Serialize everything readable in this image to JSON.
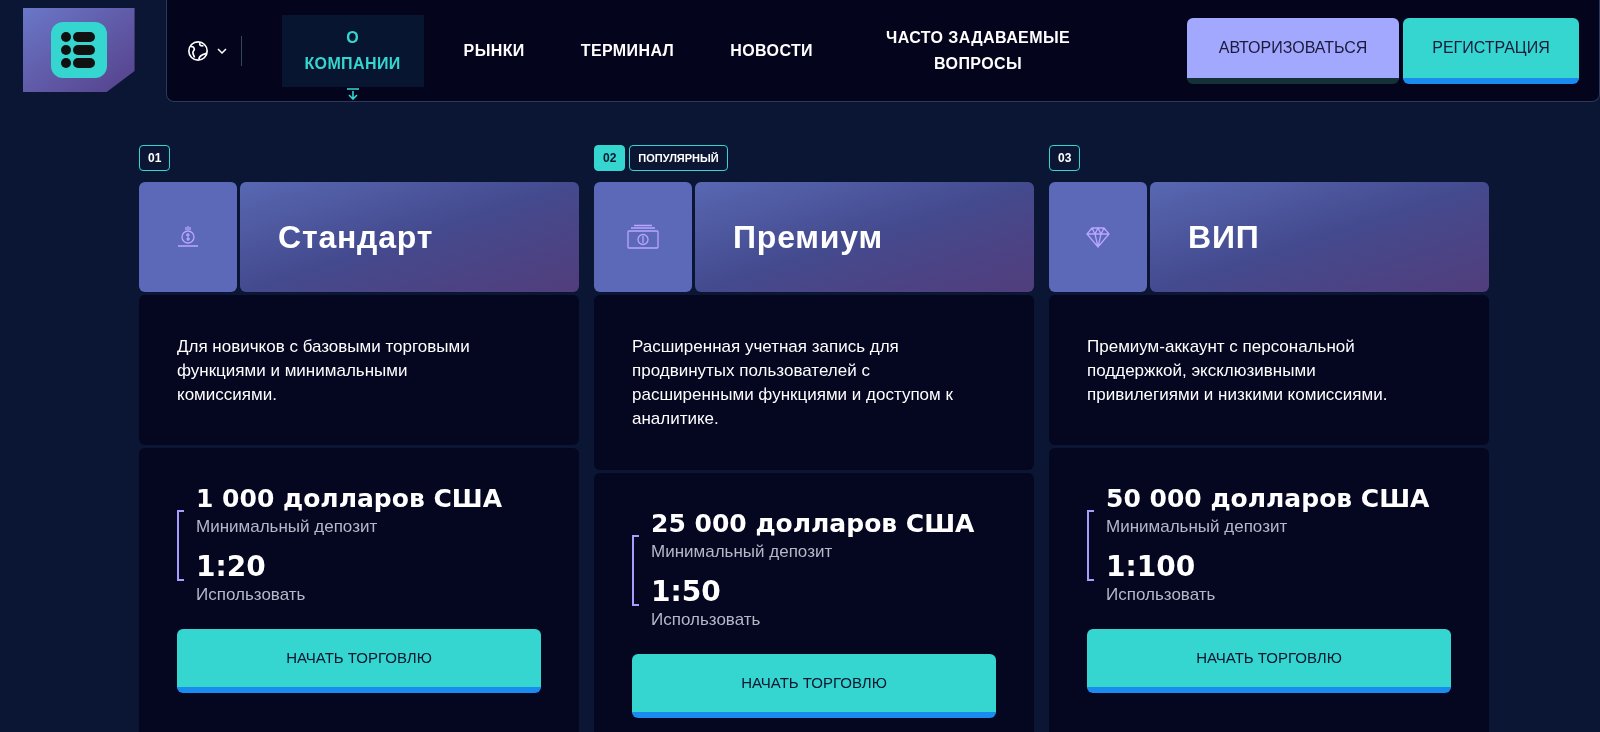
{
  "nav": {
    "items": [
      {
        "label": "О КОМПАНИИ",
        "selected": true
      },
      {
        "label": "РЫНКИ",
        "selected": false
      },
      {
        "label": "ТЕРМИНАЛ",
        "selected": false
      },
      {
        "label": "НОВОСТИ",
        "selected": false
      },
      {
        "label": "ЧАСТО ЗАДАВАЕМЫЕ ВОПРОСЫ",
        "selected": false
      }
    ],
    "login_button": "АВТОРИЗОВАТЬСЯ",
    "register_button": "РЕГИСТРАЦИЯ"
  },
  "plans": [
    {
      "number": "01",
      "selected": false,
      "kind": "coin",
      "title": "Стандарт",
      "description": "Для новичков с базовыми торговыми функциями и минимальными комиссиями.",
      "deposit": "1 000 долларов США",
      "deposit_label": "Минимальный депозит",
      "leverage": "1:20",
      "leverage_label": "Использовать",
      "button": "НАЧАТЬ ТОРГОВЛЮ"
    },
    {
      "number": "02",
      "selected": true,
      "badge": "ПОПУЛЯРНЫЙ",
      "kind": "banknote",
      "title": "Премиум",
      "description": "Расширенная учетная запись для продвинутых пользователей с расширенными функциями и доступом к аналитике.",
      "deposit": "25 000 долларов США",
      "deposit_label": "Минимальный депозит",
      "leverage": "1:50",
      "leverage_label": "Использовать",
      "button": "НАЧАТЬ ТОРГОВЛЮ"
    },
    {
      "number": "03",
      "selected": false,
      "kind": "diamond",
      "title": "ВИП",
      "description": "Премиум-аккаунт с персональной поддержкой, эксклюзивными привилегиями и низкими комиссиями.",
      "deposit": "50 000 долларов США",
      "deposit_label": "Минимальный депозит",
      "leverage": "1:100",
      "leverage_label": "Использовать",
      "button": "НАЧАТЬ ТОРГОВЛЮ"
    }
  ]
}
